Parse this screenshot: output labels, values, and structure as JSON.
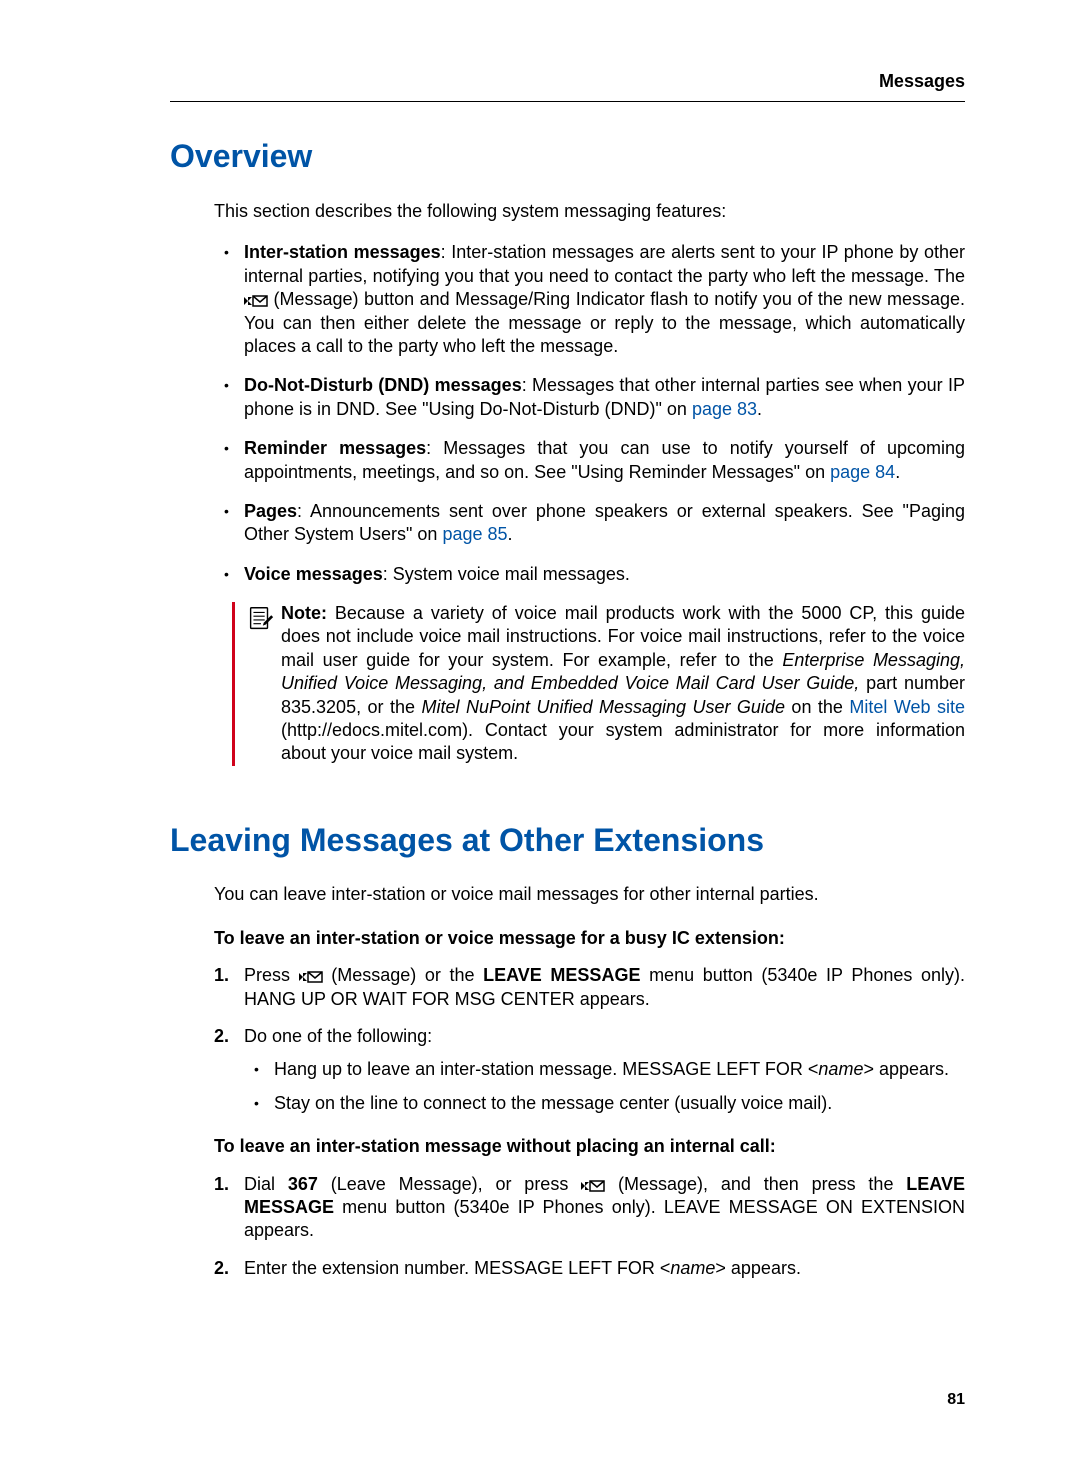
{
  "header": {
    "section_label": "Messages"
  },
  "page": {
    "number": "81"
  },
  "overview": {
    "heading": "Overview",
    "intro": "This section describes the following system messaging features:",
    "items": {
      "inter": {
        "label": "Inter-station messages",
        "text_pre": ": Inter-station messages are alerts sent to your IP phone by other internal parties, notifying you that you need to contact the party who left the message. The ",
        "text_post": " (Message) button and Message/Ring Indicator flash to notify you of the new message. You can then either delete the message or reply to the message, which automatically places a call to the party who left the message."
      },
      "dnd": {
        "label": "Do-Not-Disturb (DND) messages",
        "text": ": Messages that other internal parties see when your IP phone is in DND. See \"Using Do-Not-Disturb (DND)\" on ",
        "link": "page 83",
        "tail": "."
      },
      "reminder": {
        "label": "Reminder messages",
        "text": ": Messages that you can use to notify yourself of upcoming appointments, meetings, and so on. See \"Using Reminder Messages\" on ",
        "link": "page 84",
        "tail": "."
      },
      "pages": {
        "label": "Pages",
        "text": ": Announcements sent over phone speakers or external speakers. See \"Paging Other System Users\" on ",
        "link": "page 85",
        "tail": "."
      },
      "voice": {
        "label": "Voice messages",
        "text": ": System voice mail messages."
      }
    },
    "note": {
      "lead": "Note:",
      "part1": " Because a variety of voice mail products work with the 5000 CP, this guide does not include voice mail instructions. For voice mail instructions, refer to the voice mail user guide for your system. For example, refer to the ",
      "italic1": "Enterprise Messaging, Unified Voice Messaging, and Embedded Voice Mail Card User Guide,",
      "part2": " part number 835.3205, or the ",
      "italic2": "Mitel NuPoint Unified Messaging User Guide",
      "part3": " on the ",
      "link": "Mitel Web site",
      "part4": " (http://edocs.mitel.com). Contact your system administrator for more information about your voice mail system."
    }
  },
  "leaving": {
    "heading": "Leaving Messages at Other Extensions",
    "intro": "You can leave inter-station or voice mail messages for other internal parties.",
    "proc1": {
      "title": "To leave an inter-station or voice message for a busy IC extension:",
      "step1_pre": "Press ",
      "step1_mid": " (Message) or the ",
      "step1_bold": "LEAVE MESSAGE",
      "step1_post": " menu button (5340e IP Phones only). HANG UP OR WAIT FOR MSG CENTER appears.",
      "step2": "Do one of the following:",
      "sub1_pre": "Hang up to leave an inter-station message. MESSAGE LEFT FOR <",
      "sub1_name": "name",
      "sub1_post": "> appears.",
      "sub2": "Stay on the line to connect to the message center (usually voice mail)."
    },
    "proc2": {
      "title": "To leave an inter-station message without placing an internal call:",
      "step1_a": "Dial ",
      "step1_code": "367",
      "step1_b": " (Leave Message), or press ",
      "step1_c": " (Message), and then press the ",
      "step1_bold": "LEAVE MESSAGE",
      "step1_d": " menu button (5340e IP Phones only). LEAVE MESSAGE ON EXTENSION appears.",
      "step2_pre": "Enter the extension number. MESSAGE LEFT FOR <",
      "step2_name": "name",
      "step2_post": "> appears."
    }
  }
}
